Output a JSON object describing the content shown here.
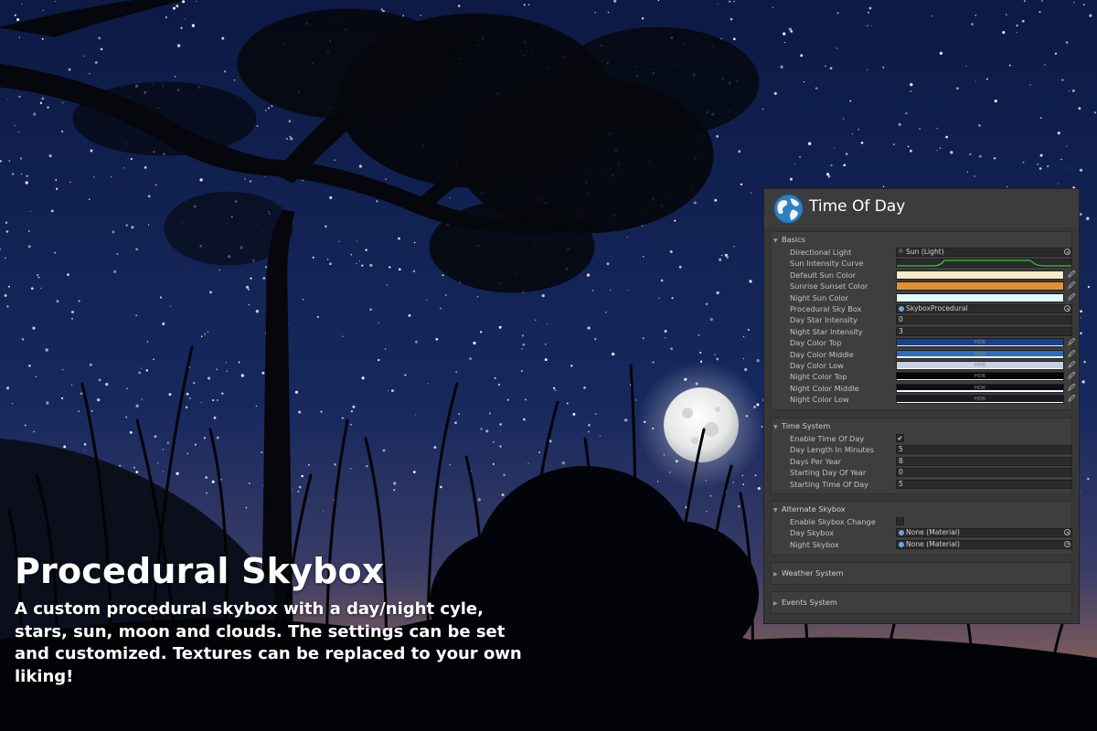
{
  "caption": {
    "title": "Procedural Skybox",
    "description": "A custom procedural skybox with a day/night cyle, stars, sun, moon and clouds. The settings can be set and customized. Textures can be replaced to your own liking!"
  },
  "scene": {
    "sky_top_color": "#0c1a44",
    "sky_mid_color": "#16285e",
    "horizon_color": "#7a5a5c",
    "moon_color": "#e6e6e6"
  },
  "inspector": {
    "title": "Time Of Day",
    "icon": "globe-icon",
    "basics": {
      "label": "Basics",
      "directional_light": {
        "label": "Directional Light",
        "value": "Sun (Light)"
      },
      "sun_intensity_curve": {
        "label": "Sun Intensity Curve",
        "curve_color": "#3fc43f"
      },
      "default_sun_color": {
        "label": "Default Sun Color",
        "color": "#fde8c8"
      },
      "sunrise_sunset_color": {
        "label": "Sunrise Sunset Color",
        "color": "#e39035"
      },
      "night_sun_color": {
        "label": "Night Sun Color",
        "color": "#e3f8f8"
      },
      "procedural_sky_box": {
        "label": "Procedural Sky Box",
        "value": "SkyboxProcedural"
      },
      "day_star_intensity": {
        "label": "Day Star Intensity",
        "value": "0"
      },
      "night_star_intensity": {
        "label": "Night Star Intensity",
        "value": "3"
      },
      "day_color_top": {
        "label": "Day Color Top",
        "color": "#1c3f8a",
        "tag": "HDR"
      },
      "day_color_middle": {
        "label": "Day Color Middle",
        "color": "#2a6fc0",
        "tag": "HDR"
      },
      "day_color_low": {
        "label": "Day Color Low",
        "color": "#c7cfe6",
        "tag": "HDR"
      },
      "night_color_top": {
        "label": "Night Color Top",
        "color": "#050505",
        "tag": "HDR"
      },
      "night_color_middle": {
        "label": "Night Color Middle",
        "color": "#0b1018",
        "tag": "HDR"
      },
      "night_color_low": {
        "label": "Night Color Low",
        "color": "#1a1c24",
        "tag": "HDR"
      }
    },
    "time_system": {
      "label": "Time System",
      "enable_time_of_day": {
        "label": "Enable Time Of Day",
        "checked": true
      },
      "day_length_in_minutes": {
        "label": "Day Length In Minutes",
        "value": "5"
      },
      "days_per_year": {
        "label": "Days Per Year",
        "value": "8"
      },
      "starting_day_of_year": {
        "label": "Starting Day Of Year",
        "value": "0"
      },
      "starting_time_of_day": {
        "label": "Starting Time Of Day",
        "value": "5"
      }
    },
    "alternate_skybox": {
      "label": "Alternate Skybox",
      "enable_skybox_change": {
        "label": "Enable Skybox Change",
        "checked": false
      },
      "day_skybox": {
        "label": "Day Skybox",
        "value": "None (Material)"
      },
      "night_skybox": {
        "label": "Night Skybox",
        "value": "None (Material)"
      }
    },
    "weather_system": {
      "label": "Weather System"
    },
    "events_system": {
      "label": "Events System"
    }
  }
}
